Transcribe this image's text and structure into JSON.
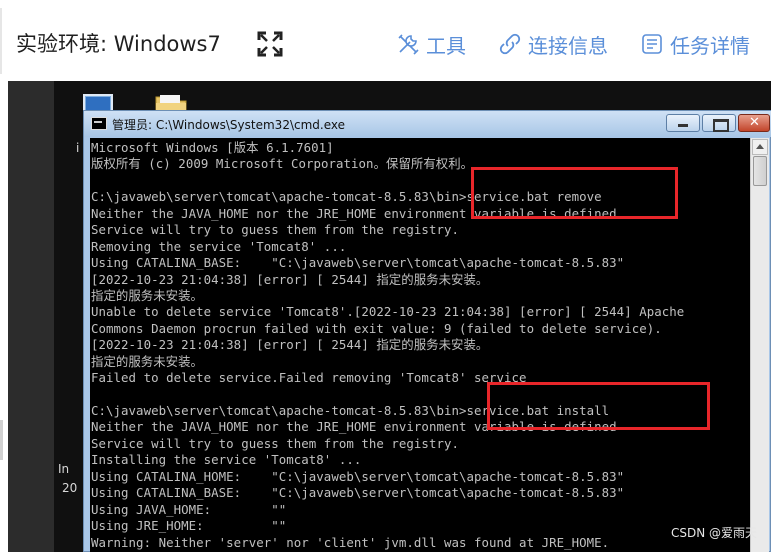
{
  "header": {
    "env_title": "实验环境: Windows7",
    "toolbar": {
      "tools_label": "工具",
      "connection_label": "连接信息",
      "task_label": "任务详情"
    },
    "icons": {
      "fullscreen": "fullscreen-icon",
      "tools": "tools-icon",
      "connection": "link-icon",
      "task": "task-list-icon"
    },
    "accent_color": "#5b8fd9"
  },
  "desktop": {
    "fragments": [
      "i",
      "In",
      "20"
    ],
    "watermark": "CSDN @爱雨天"
  },
  "cmd_window": {
    "title": "管理员: C:\\Windows\\System32\\cmd.exe",
    "lines": [
      "Microsoft Windows [版本 6.1.7601]",
      "版权所有 (c) 2009 Microsoft Corporation。保留所有权利。",
      "",
      "C:\\javaweb\\server\\tomcat\\apache-tomcat-8.5.83\\bin>service.bat remove",
      "Neither the JAVA_HOME nor the JRE_HOME environment variable is defined",
      "Service will try to guess them from the registry.",
      "Removing the service 'Tomcat8' ...",
      "Using CATALINA_BASE:    \"C:\\javaweb\\server\\tomcat\\apache-tomcat-8.5.83\"",
      "[2022-10-23 21:04:38] [error] [ 2544] 指定的服务未安装。",
      "指定的服务未安装。",
      "Unable to delete service 'Tomcat8'.[2022-10-23 21:04:38] [error] [ 2544] Apache",
      "Commons Daemon procrun failed with exit value: 9 (failed to delete service).",
      "[2022-10-23 21:04:38] [error] [ 2544] 指定的服务未安装。",
      "指定的服务未安装。",
      "Failed to delete service.Failed removing 'Tomcat8' service",
      "",
      "C:\\javaweb\\server\\tomcat\\apache-tomcat-8.5.83\\bin>service.bat install",
      "Neither the JAVA_HOME nor the JRE_HOME environment variable is defined",
      "Service will try to guess them from the registry.",
      "Installing the service 'Tomcat8' ...",
      "Using CATALINA_HOME:    \"C:\\javaweb\\server\\tomcat\\apache-tomcat-8.5.83\"",
      "Using CATALINA_BASE:    \"C:\\javaweb\\server\\tomcat\\apache-tomcat-8.5.83\"",
      "Using JAVA_HOME:        \"\"",
      "Using JRE_HOME:         \"\"",
      "Warning: Neither 'server' nor 'client' jvm.dll was found at JRE_HOME."
    ],
    "highlight_color": "#e8262a"
  }
}
